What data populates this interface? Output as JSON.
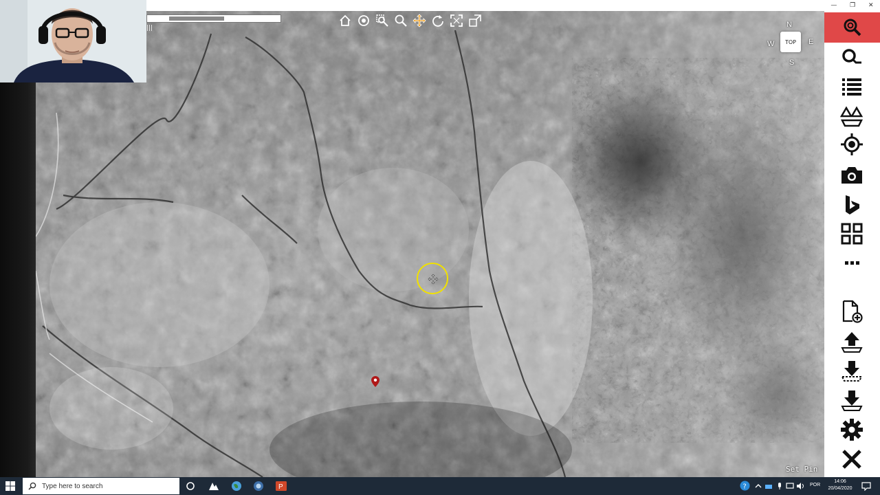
{
  "map": {
    "compass": {
      "north": "N",
      "south": "S",
      "east": "E",
      "west": "W",
      "view_label": "TOP"
    },
    "status_text": "Set Pin"
  },
  "toolbar": {
    "tools": [
      "home-icon",
      "orbit-icon",
      "zoom-window-icon",
      "zoom-icon",
      "pan-icon",
      "rotate-icon",
      "fit-view-icon",
      "full-extent-icon"
    ],
    "active_tool": "pan-icon",
    "accent": "#f0a020"
  },
  "sidebar": {
    "accent": "#e04848",
    "items": [
      "search-location-icon",
      "search-icon",
      "list-icon",
      "layers-icon",
      "gps-target-icon",
      "camera-icon",
      "bing-icon",
      "grid-icon",
      "more-icon",
      "add-file-icon",
      "upload-icon",
      "download-icon",
      "download-alt-icon",
      "settings-icon",
      "close-icon"
    ]
  },
  "taskbar": {
    "search_placeholder": "Type here to search",
    "language": "POR",
    "time": "14:06",
    "date": "20/04/2020"
  }
}
